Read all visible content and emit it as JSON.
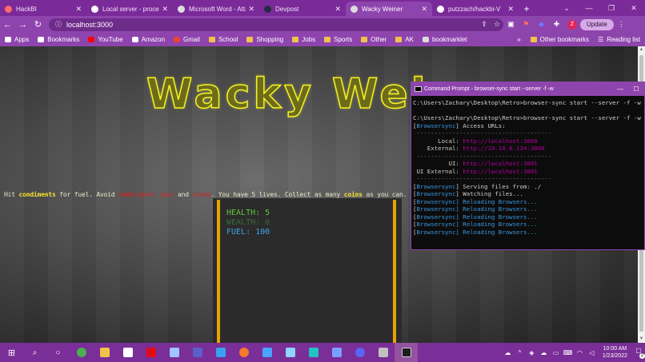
{
  "browser": {
    "tabs": [
      {
        "title": "HackBI",
        "favicon": "hackbi-icon",
        "color": "#ff6b6b",
        "active": false
      },
      {
        "title": "Local server - processi",
        "favicon": "github-icon",
        "color": "#ffffff",
        "active": false
      },
      {
        "title": "Microsoft Word - Atta",
        "favicon": "globe-icon",
        "color": "#dddddd",
        "active": false
      },
      {
        "title": "Devpost",
        "favicon": "devpost-icon",
        "color": "#1f2d3d",
        "active": false
      },
      {
        "title": "Wacky Weiner",
        "favicon": "globe-icon",
        "color": "#dddddd",
        "active": true
      },
      {
        "title": "putzzach/hackbi-V",
        "favicon": "github-icon",
        "color": "#ffffff",
        "active": false
      }
    ],
    "url": "localhost:3000",
    "update_label": "Update",
    "profile_initial": "Z",
    "bookmarks": [
      {
        "label": "Apps",
        "icon": "apps-grid-icon"
      },
      {
        "label": "Bookmarks",
        "icon": "star-icon"
      },
      {
        "label": "YouTube",
        "icon": "youtube-icon"
      },
      {
        "label": "Amazon",
        "icon": "amazon-icon"
      },
      {
        "label": "Gmail",
        "icon": "gmail-icon"
      },
      {
        "label": "School",
        "icon": "folder-icon"
      },
      {
        "label": "Shopping",
        "icon": "folder-icon"
      },
      {
        "label": "Jobs",
        "icon": "folder-icon"
      },
      {
        "label": "Sports",
        "icon": "folder-icon"
      },
      {
        "label": "Other",
        "icon": "folder-icon"
      },
      {
        "label": "AK",
        "icon": "folder-icon"
      },
      {
        "label": "bookmarklet",
        "icon": "globe-icon"
      }
    ],
    "other_bookmarks": "Other bookmarks",
    "reading_list": "Reading list"
  },
  "game": {
    "title": "Wacky Weiner",
    "intro": {
      "p1": "Hit ",
      "condiments": "condiments",
      "p2": " for fuel. Avoid ",
      "hamburgers": "hamburgers (ew)",
      "p3": " and ",
      "cones": "cones",
      "p4": ". You have 5 lives. Collect as many ",
      "coins": "coins",
      "p5": " as you can."
    },
    "stats": {
      "health": "HEALTH: 5",
      "wealth": "WEALTH: 0",
      "fuel": "FUEL: 100"
    },
    "colors": {
      "title": "#f5f122",
      "highlight": "#f5e030",
      "danger": "#e02020",
      "rail": "#e8a200"
    }
  },
  "cmd": {
    "title": "Command Prompt - browser-sync  start --server -f -w",
    "lines": [
      {
        "parts": [
          {
            "t": "C:\\Users\\Zachary\\Desktop\\Retro>browser-sync start --server -f -w",
            "c": ""
          }
        ]
      },
      {
        "parts": [
          {
            "t": "",
            "c": ""
          }
        ]
      },
      {
        "parts": [
          {
            "t": "C:\\Users\\Zachary\\Desktop\\Retro>browser-sync start --server -f -w",
            "c": ""
          }
        ]
      },
      {
        "parts": [
          {
            "t": "[",
            "c": ""
          },
          {
            "t": "Browsersync",
            "c": "bs"
          },
          {
            "t": "] Access URLs:",
            "c": ""
          }
        ]
      },
      {
        "parts": [
          {
            "t": " --------------------------------------",
            "c": "grey"
          }
        ]
      },
      {
        "parts": [
          {
            "t": "       Local: ",
            "c": ""
          },
          {
            "t": "http://localhost:3000",
            "c": "pink"
          }
        ]
      },
      {
        "parts": [
          {
            "t": "    External: ",
            "c": ""
          },
          {
            "t": "http://10.10.0.134:3000",
            "c": "pink"
          }
        ]
      },
      {
        "parts": [
          {
            "t": " --------------------------------------",
            "c": "grey"
          }
        ]
      },
      {
        "parts": [
          {
            "t": "          UI: ",
            "c": ""
          },
          {
            "t": "http://localhost:3001",
            "c": "pink"
          }
        ]
      },
      {
        "parts": [
          {
            "t": " UI External: ",
            "c": ""
          },
          {
            "t": "http://localhost:3001",
            "c": "pink"
          }
        ]
      },
      {
        "parts": [
          {
            "t": " --------------------------------------",
            "c": "grey"
          }
        ]
      },
      {
        "parts": [
          {
            "t": "[",
            "c": ""
          },
          {
            "t": "Browsersync",
            "c": "bs"
          },
          {
            "t": "] Serving files from: ./",
            "c": ""
          }
        ]
      },
      {
        "parts": [
          {
            "t": "[",
            "c": ""
          },
          {
            "t": "Browsersync",
            "c": "bs"
          },
          {
            "t": "] Watching files...",
            "c": ""
          }
        ]
      },
      {
        "parts": [
          {
            "t": "[",
            "c": ""
          },
          {
            "t": "Browsersync",
            "c": "bs"
          },
          {
            "t": "] Reloading Browsers...",
            "c": "bs"
          }
        ]
      },
      {
        "parts": [
          {
            "t": "[",
            "c": ""
          },
          {
            "t": "Browsersync",
            "c": "bs"
          },
          {
            "t": "] Reloading Browsers...",
            "c": "bs"
          }
        ]
      },
      {
        "parts": [
          {
            "t": "[",
            "c": ""
          },
          {
            "t": "Browsersync",
            "c": "bs"
          },
          {
            "t": "] Reloading Browsers...",
            "c": "bs"
          }
        ]
      },
      {
        "parts": [
          {
            "t": "[",
            "c": ""
          },
          {
            "t": "Browsersync",
            "c": "bs"
          },
          {
            "t": "] Reloading Browsers...",
            "c": "bs"
          }
        ]
      },
      {
        "parts": [
          {
            "t": "[",
            "c": ""
          },
          {
            "t": "Browsersync",
            "c": "bs"
          },
          {
            "t": "] Reloading Browsers...",
            "c": "bs"
          }
        ]
      }
    ]
  },
  "taskbar": {
    "apps": [
      {
        "name": "search-icon",
        "color": "#ffffff"
      },
      {
        "name": "cortana-icon",
        "color": "#ffffff"
      },
      {
        "name": "chrome-icon",
        "color": "#4caf50"
      },
      {
        "name": "file-explorer-icon",
        "color": "#f0c24b"
      },
      {
        "name": "amazon-app-icon",
        "color": "#ffffff"
      },
      {
        "name": "netflix-icon",
        "color": "#e50914"
      },
      {
        "name": "app-icon",
        "color": "#a0c4ff"
      },
      {
        "name": "teams-icon",
        "color": "#5b5fc7"
      },
      {
        "name": "vscode-icon",
        "color": "#3aa0f0"
      },
      {
        "name": "blender-icon",
        "color": "#f5792a"
      },
      {
        "name": "app-icon-2",
        "color": "#4aa3ff"
      },
      {
        "name": "app-icon-3",
        "color": "#8fd3ff"
      },
      {
        "name": "app-icon-4",
        "color": "#22c3c3"
      },
      {
        "name": "app-icon-5",
        "color": "#7aa0ff"
      },
      {
        "name": "discord-icon",
        "color": "#5865f2"
      },
      {
        "name": "app-icon-6",
        "color": "#c0c0c0"
      },
      {
        "name": "terminal-icon",
        "color": "#1e1e1e"
      }
    ],
    "time": "10:00 AM",
    "date": "1/23/2022",
    "notification_count": "2"
  }
}
